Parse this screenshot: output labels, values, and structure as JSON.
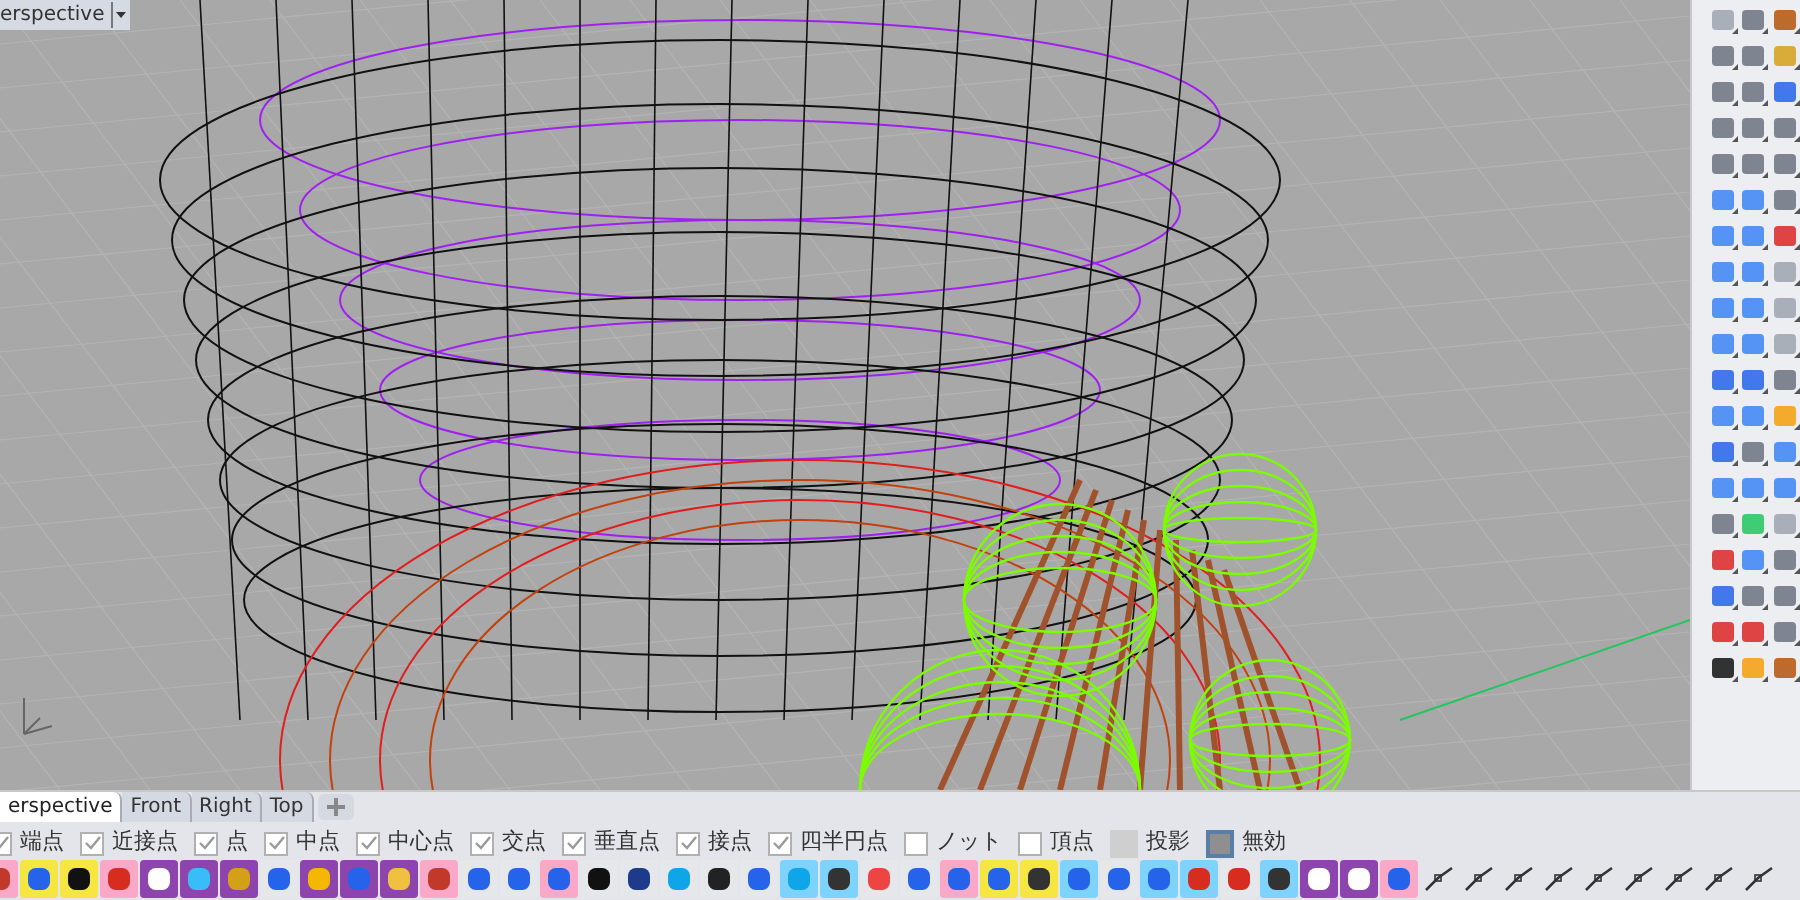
{
  "viewport": {
    "title": "erspective"
  },
  "tabs": [
    {
      "label": "erspective",
      "selected": true
    },
    {
      "label": "Front",
      "selected": false
    },
    {
      "label": "Right",
      "selected": false
    },
    {
      "label": "Top",
      "selected": false
    }
  ],
  "osnaps": [
    {
      "kind": "checkbox",
      "label": "端点",
      "checked": true
    },
    {
      "kind": "checkbox",
      "label": "近接点",
      "checked": true
    },
    {
      "kind": "checkbox",
      "label": "点",
      "checked": true
    },
    {
      "kind": "checkbox",
      "label": "中点",
      "checked": true
    },
    {
      "kind": "checkbox",
      "label": "中心点",
      "checked": true
    },
    {
      "kind": "checkbox",
      "label": "交点",
      "checked": true
    },
    {
      "kind": "checkbox",
      "label": "垂直点",
      "checked": true
    },
    {
      "kind": "checkbox",
      "label": "接点",
      "checked": true
    },
    {
      "kind": "checkbox",
      "label": "四半円点",
      "checked": true
    },
    {
      "kind": "checkbox",
      "label": "ノット",
      "checked": false
    },
    {
      "kind": "checkbox",
      "label": "頂点",
      "checked": false
    },
    {
      "kind": "toggle",
      "label": "投影",
      "checked": false
    },
    {
      "kind": "toggle",
      "label": "無効",
      "checked": true
    }
  ]
}
